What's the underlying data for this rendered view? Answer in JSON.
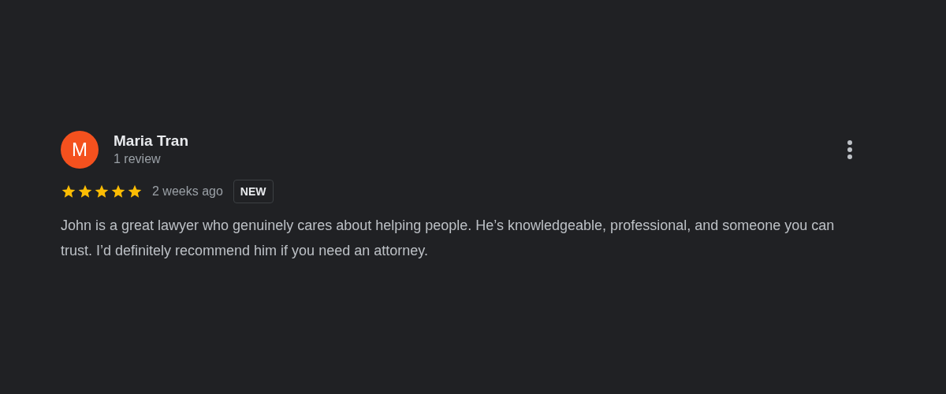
{
  "review": {
    "avatar": {
      "letter": "M",
      "color": "#f4511e"
    },
    "name": "Maria Tran",
    "reviewer_meta": "1 review",
    "stars": 5,
    "time": "2 weeks ago",
    "badge": "NEW",
    "text": "John is a great lawyer who genuinely cares about helping people. He’s knowledgeable, professional, and someone you can trust. I’d definitely recommend him if you need an attorney."
  }
}
